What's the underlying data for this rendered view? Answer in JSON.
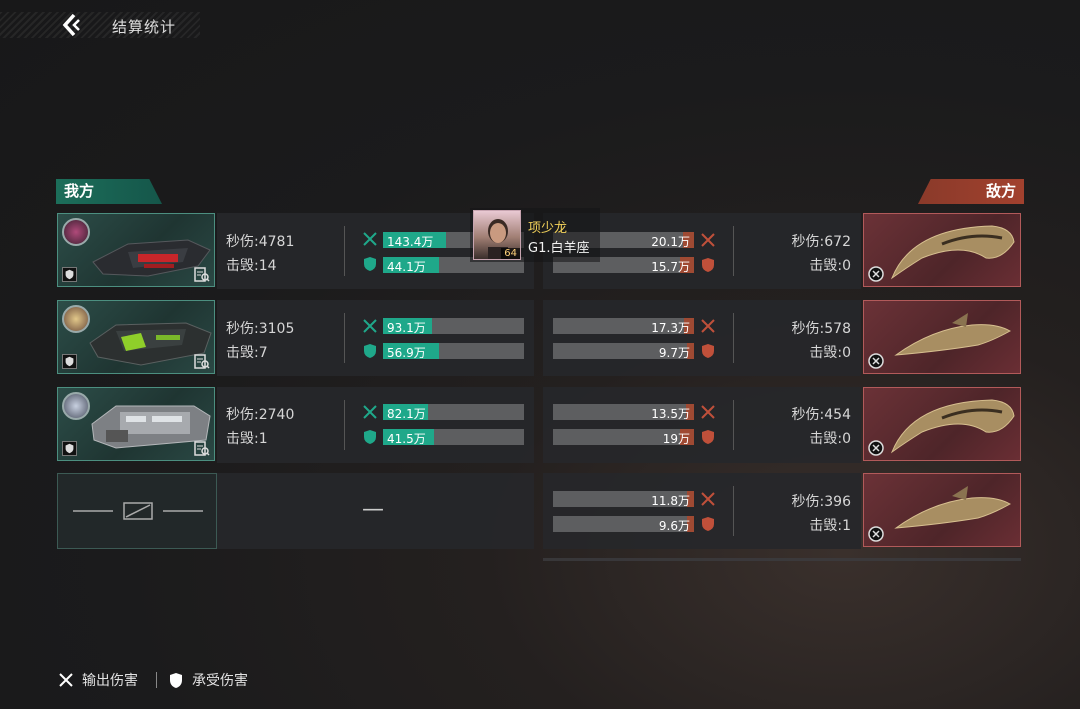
{
  "header": {
    "title": "结算统计"
  },
  "sides": {
    "ally": "我方",
    "enemy": "敌方"
  },
  "labels": {
    "dps": "秒伤:",
    "kills": "击毁:"
  },
  "ally_rows": [
    {
      "dps": "4781",
      "kills": "14",
      "dealt": "143.4万",
      "taken": "44.1万",
      "dealt_pct": 0.45,
      "taken_pct": 0.4
    },
    {
      "dps": "3105",
      "kills": "7",
      "dealt": "93.1万",
      "taken": "56.9万",
      "dealt_pct": 0.35,
      "taken_pct": 0.4
    },
    {
      "dps": "2740",
      "kills": "1",
      "dealt": "82.1万",
      "taken": "41.5万",
      "dealt_pct": 0.32,
      "taken_pct": 0.36
    }
  ],
  "ally_empty": {
    "dash": "—"
  },
  "enemy_rows": [
    {
      "dps": "672",
      "kills": "0",
      "dealt": "20.1万",
      "taken": "15.7万",
      "dealt_pct": 0.08,
      "taken_pct": 0.1
    },
    {
      "dps": "578",
      "kills": "0",
      "dealt": "17.3万",
      "taken": "9.7万",
      "dealt_pct": 0.07,
      "taken_pct": 0.05
    },
    {
      "dps": "454",
      "kills": "0",
      "dealt": "13.5万",
      "taken": "19万",
      "dealt_pct": 0.06,
      "taken_pct": 0.1
    },
    {
      "dps": "396",
      "kills": "1",
      "dealt": "11.8万",
      "taken": "9.6万",
      "dealt_pct": 0.05,
      "taken_pct": 0.05
    }
  ],
  "tooltip": {
    "name": "项少龙",
    "rank": "G1.白羊座",
    "level": "64"
  },
  "legend": {
    "dealt": "输出伤害",
    "taken": "承受伤害"
  },
  "colors": {
    "ally_accent": "#1fa88a",
    "enemy_accent": "#9f4a33",
    "name_gold": "#f3d25a"
  },
  "icons": {
    "back": "chevron-left-icon",
    "dealt": "crossed-swords-icon",
    "taken": "shield-icon",
    "detail": "document-search-icon",
    "target": "crosshair-icon"
  }
}
